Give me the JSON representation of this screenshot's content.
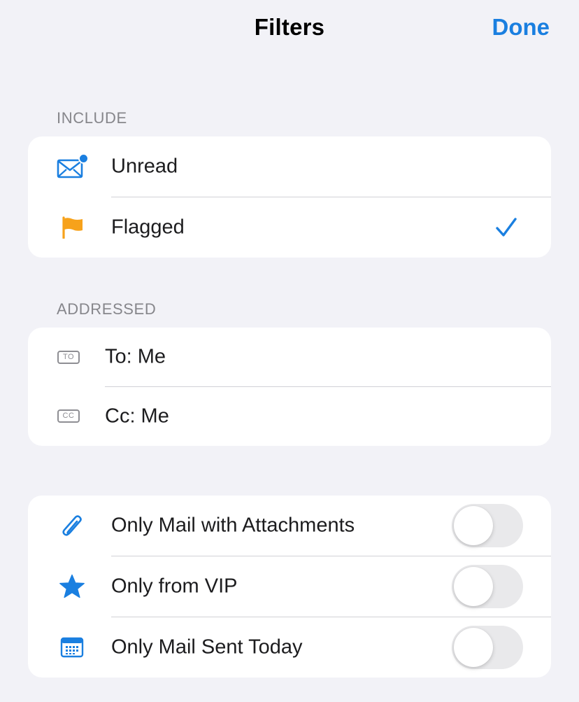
{
  "nav": {
    "title": "Filters",
    "done_label": "Done"
  },
  "include": {
    "header": "INCLUDE",
    "items": [
      {
        "label": "Unread",
        "icon": "unread-envelope-icon",
        "checked": false
      },
      {
        "label": "Flagged",
        "icon": "flag-icon",
        "checked": true
      }
    ]
  },
  "addressed": {
    "header": "ADDRESSED",
    "items": [
      {
        "label": "To: Me",
        "icon": "to-badge-icon",
        "badge_text": "TO"
      },
      {
        "label": "Cc: Me",
        "icon": "cc-badge-icon",
        "badge_text": "CC"
      }
    ]
  },
  "options": {
    "items": [
      {
        "label": "Only Mail with Attachments",
        "icon": "paperclip-icon",
        "on": false
      },
      {
        "label": "Only from VIP",
        "icon": "star-icon",
        "on": false
      },
      {
        "label": "Only Mail Sent Today",
        "icon": "calendar-icon",
        "on": false
      }
    ]
  },
  "colors": {
    "accent": "#1a7fe0",
    "flag": "#f7a21b",
    "background": "#f2f2f7",
    "card": "#ffffff",
    "toggle_off": "#e9e9eb"
  }
}
